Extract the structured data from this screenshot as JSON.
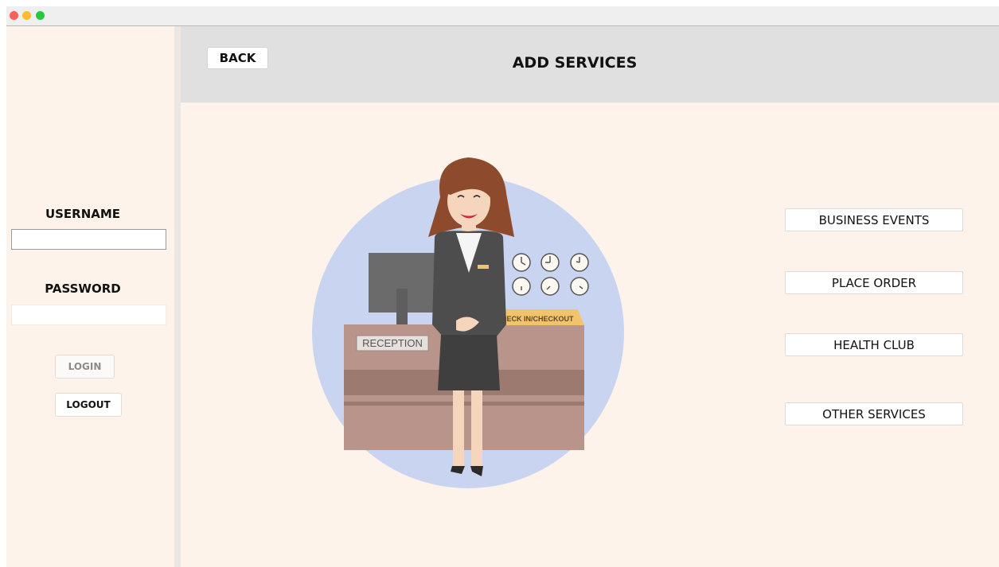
{
  "sidebar": {
    "username_label": "USERNAME",
    "username_value": "",
    "password_label": "PASSWORD",
    "password_value": "",
    "login_label": "LOGIN",
    "logout_label": "LOGOUT"
  },
  "header": {
    "back_label": "BACK",
    "title": "ADD SERVICES"
  },
  "illustration": {
    "reception_sign": "RECEPTION",
    "checkin_sign": "CHECK IN/CHECKOUT"
  },
  "services": [
    {
      "label": "BUSINESS EVENTS"
    },
    {
      "label": "PLACE ORDER"
    },
    {
      "label": "HEALTH CLUB"
    },
    {
      "label": "OTHER SERVICES"
    }
  ],
  "colors": {
    "background": "#fdf3ea",
    "header_bg": "#e0e0e0",
    "illustration_circle": "#c9d5f0",
    "desk": "#b8948a"
  }
}
